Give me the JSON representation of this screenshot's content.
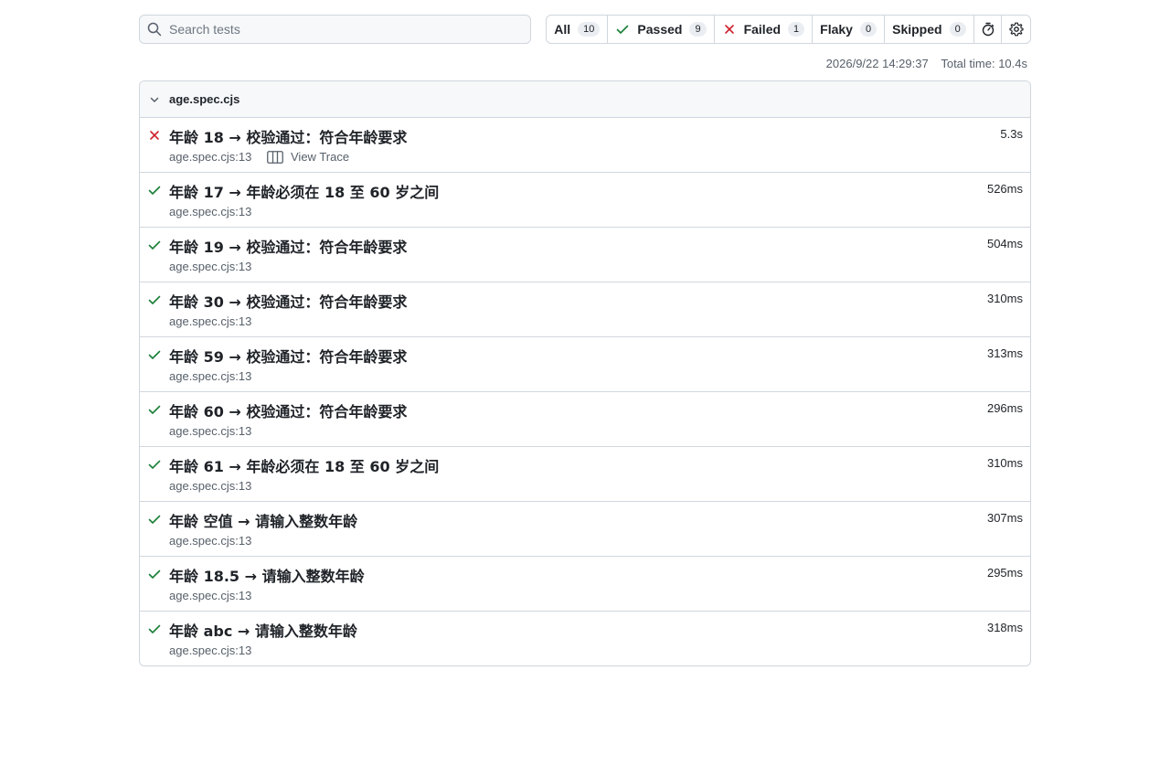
{
  "search": {
    "placeholder": "Search tests"
  },
  "filters": [
    {
      "label": "All",
      "count": "10",
      "icon": ""
    },
    {
      "label": "Passed",
      "count": "9",
      "icon": "check-icon"
    },
    {
      "label": "Failed",
      "count": "1",
      "icon": "x-icon"
    },
    {
      "label": "Flaky",
      "count": "0",
      "icon": ""
    },
    {
      "label": "Skipped",
      "count": "0",
      "icon": ""
    }
  ],
  "toolbar_icons": [
    "stopwatch-icon",
    "gear-icon"
  ],
  "meta": {
    "timestamp": "2026/9/22 14:29:37",
    "total_time": "Total time: 10.4s"
  },
  "file": {
    "name": "age.spec.cjs"
  },
  "tests": [
    {
      "status": "failed",
      "title": "年龄 18 → 校验通过：符合年龄要求",
      "duration": "5.3s",
      "location": "age.spec.cjs:13",
      "trace": "View Trace"
    },
    {
      "status": "passed",
      "title": "年龄 17 → 年龄必须在 18 至 60 岁之间",
      "duration": "526ms",
      "location": "age.spec.cjs:13"
    },
    {
      "status": "passed",
      "title": "年龄 19 → 校验通过：符合年龄要求",
      "duration": "504ms",
      "location": "age.spec.cjs:13"
    },
    {
      "status": "passed",
      "title": "年龄 30 → 校验通过：符合年龄要求",
      "duration": "310ms",
      "location": "age.spec.cjs:13"
    },
    {
      "status": "passed",
      "title": "年龄 59 → 校验通过：符合年龄要求",
      "duration": "313ms",
      "location": "age.spec.cjs:13"
    },
    {
      "status": "passed",
      "title": "年龄 60 → 校验通过：符合年龄要求",
      "duration": "296ms",
      "location": "age.spec.cjs:13"
    },
    {
      "status": "passed",
      "title": "年龄 61 → 年龄必须在 18 至 60 岁之间",
      "duration": "310ms",
      "location": "age.spec.cjs:13"
    },
    {
      "status": "passed",
      "title": "年龄 空值 → 请输入整数年龄",
      "duration": "307ms",
      "location": "age.spec.cjs:13"
    },
    {
      "status": "passed",
      "title": "年龄 18.5 → 请输入整数年龄",
      "duration": "295ms",
      "location": "age.spec.cjs:13"
    },
    {
      "status": "passed",
      "title": "年龄 abc → 请输入整数年龄",
      "duration": "318ms",
      "location": "age.spec.cjs:13"
    }
  ],
  "colors": {
    "passed": "#1a7f37",
    "failed": "#cf222e",
    "border": "#d0d7de",
    "muted": "#57606a"
  }
}
